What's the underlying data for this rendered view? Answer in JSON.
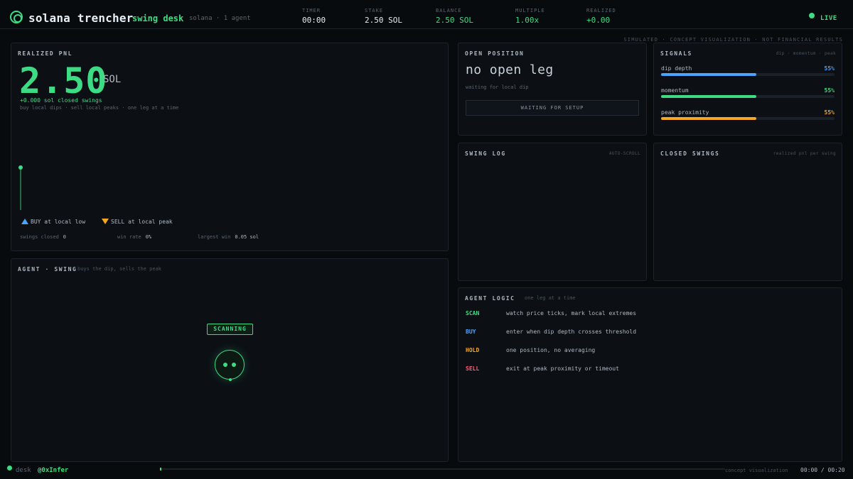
{
  "header": {
    "brand": "solana trencher",
    "desk_name": "swing desk",
    "desk_meta": "solana · 1 agent",
    "stats": [
      {
        "label": "TIMER",
        "value": "00:00",
        "accent": false
      },
      {
        "label": "STAKE",
        "value": "2.50 SOL",
        "accent": false
      },
      {
        "label": "BALANCE",
        "value": "2.50 SOL",
        "accent": true
      },
      {
        "label": "MULTIPLE",
        "value": "1.00x",
        "accent": true
      },
      {
        "label": "REALIZED",
        "value": "+0.00",
        "accent": true
      }
    ],
    "live_label": "LIVE",
    "disclaimer": "SIMULATED · CONCEPT VISUALIZATION · NOT FINANCIAL RESULTS"
  },
  "pnl": {
    "title": "REALIZED PNL",
    "value": "2.50",
    "unit": "SOL",
    "subline": "+0.000 sol closed swings",
    "tagline": "buy local dips · sell local peaks · one leg at a time",
    "legend_buy": "BUY at local low",
    "legend_sell": "SELL at local peak",
    "stats": [
      {
        "label": "swings closed",
        "value": "0"
      },
      {
        "label": "win rate",
        "value": "0%"
      },
      {
        "label": "largest win",
        "value": "0.05 sol"
      }
    ]
  },
  "agent": {
    "title": "AGENT · SWING",
    "subtitle": "buys the dip, sells the peak",
    "status": "SCANNING"
  },
  "open_position": {
    "title": "OPEN POSITION",
    "main": "no open leg",
    "sub": "waiting for local dip",
    "button": "WAITING FOR SETUP"
  },
  "signals": {
    "title": "SIGNALS",
    "hint": "dip · momentum · peak",
    "items": [
      {
        "label": "dip depth",
        "pct_text": "55%",
        "fraction": 0.55,
        "color": "#4aa3ff"
      },
      {
        "label": "momentum",
        "pct_text": "55%",
        "fraction": 0.55,
        "color": "#3ddc84"
      },
      {
        "label": "peak proximity",
        "pct_text": "55%",
        "fraction": 0.55,
        "color": "#f5a623"
      }
    ]
  },
  "swing_log": {
    "title": "SWING LOG",
    "hint": "AUTO-SCROLL"
  },
  "closed_swings": {
    "title": "CLOSED SWINGS",
    "hint": "realized pnl per swing"
  },
  "agent_logic": {
    "title": "AGENT LOGIC",
    "hint": "one leg at a time",
    "rows": [
      {
        "key": "SCAN",
        "desc": "watch price ticks, mark local extremes",
        "color": "#3ddc84"
      },
      {
        "key": "BUY",
        "desc": "enter when dip depth crosses threshold",
        "color": "#4aa3ff"
      },
      {
        "key": "HOLD",
        "desc": "one position, no averaging",
        "color": "#f5a623"
      },
      {
        "key": "SELL",
        "desc": "exit at peak proximity or timeout",
        "color": "#ff5c7a"
      }
    ]
  },
  "footer": {
    "desk": "desk",
    "handle": "@0xInfer",
    "concept": "concept visualization",
    "time": "00:00 / 00:20",
    "progress": 0.0
  }
}
